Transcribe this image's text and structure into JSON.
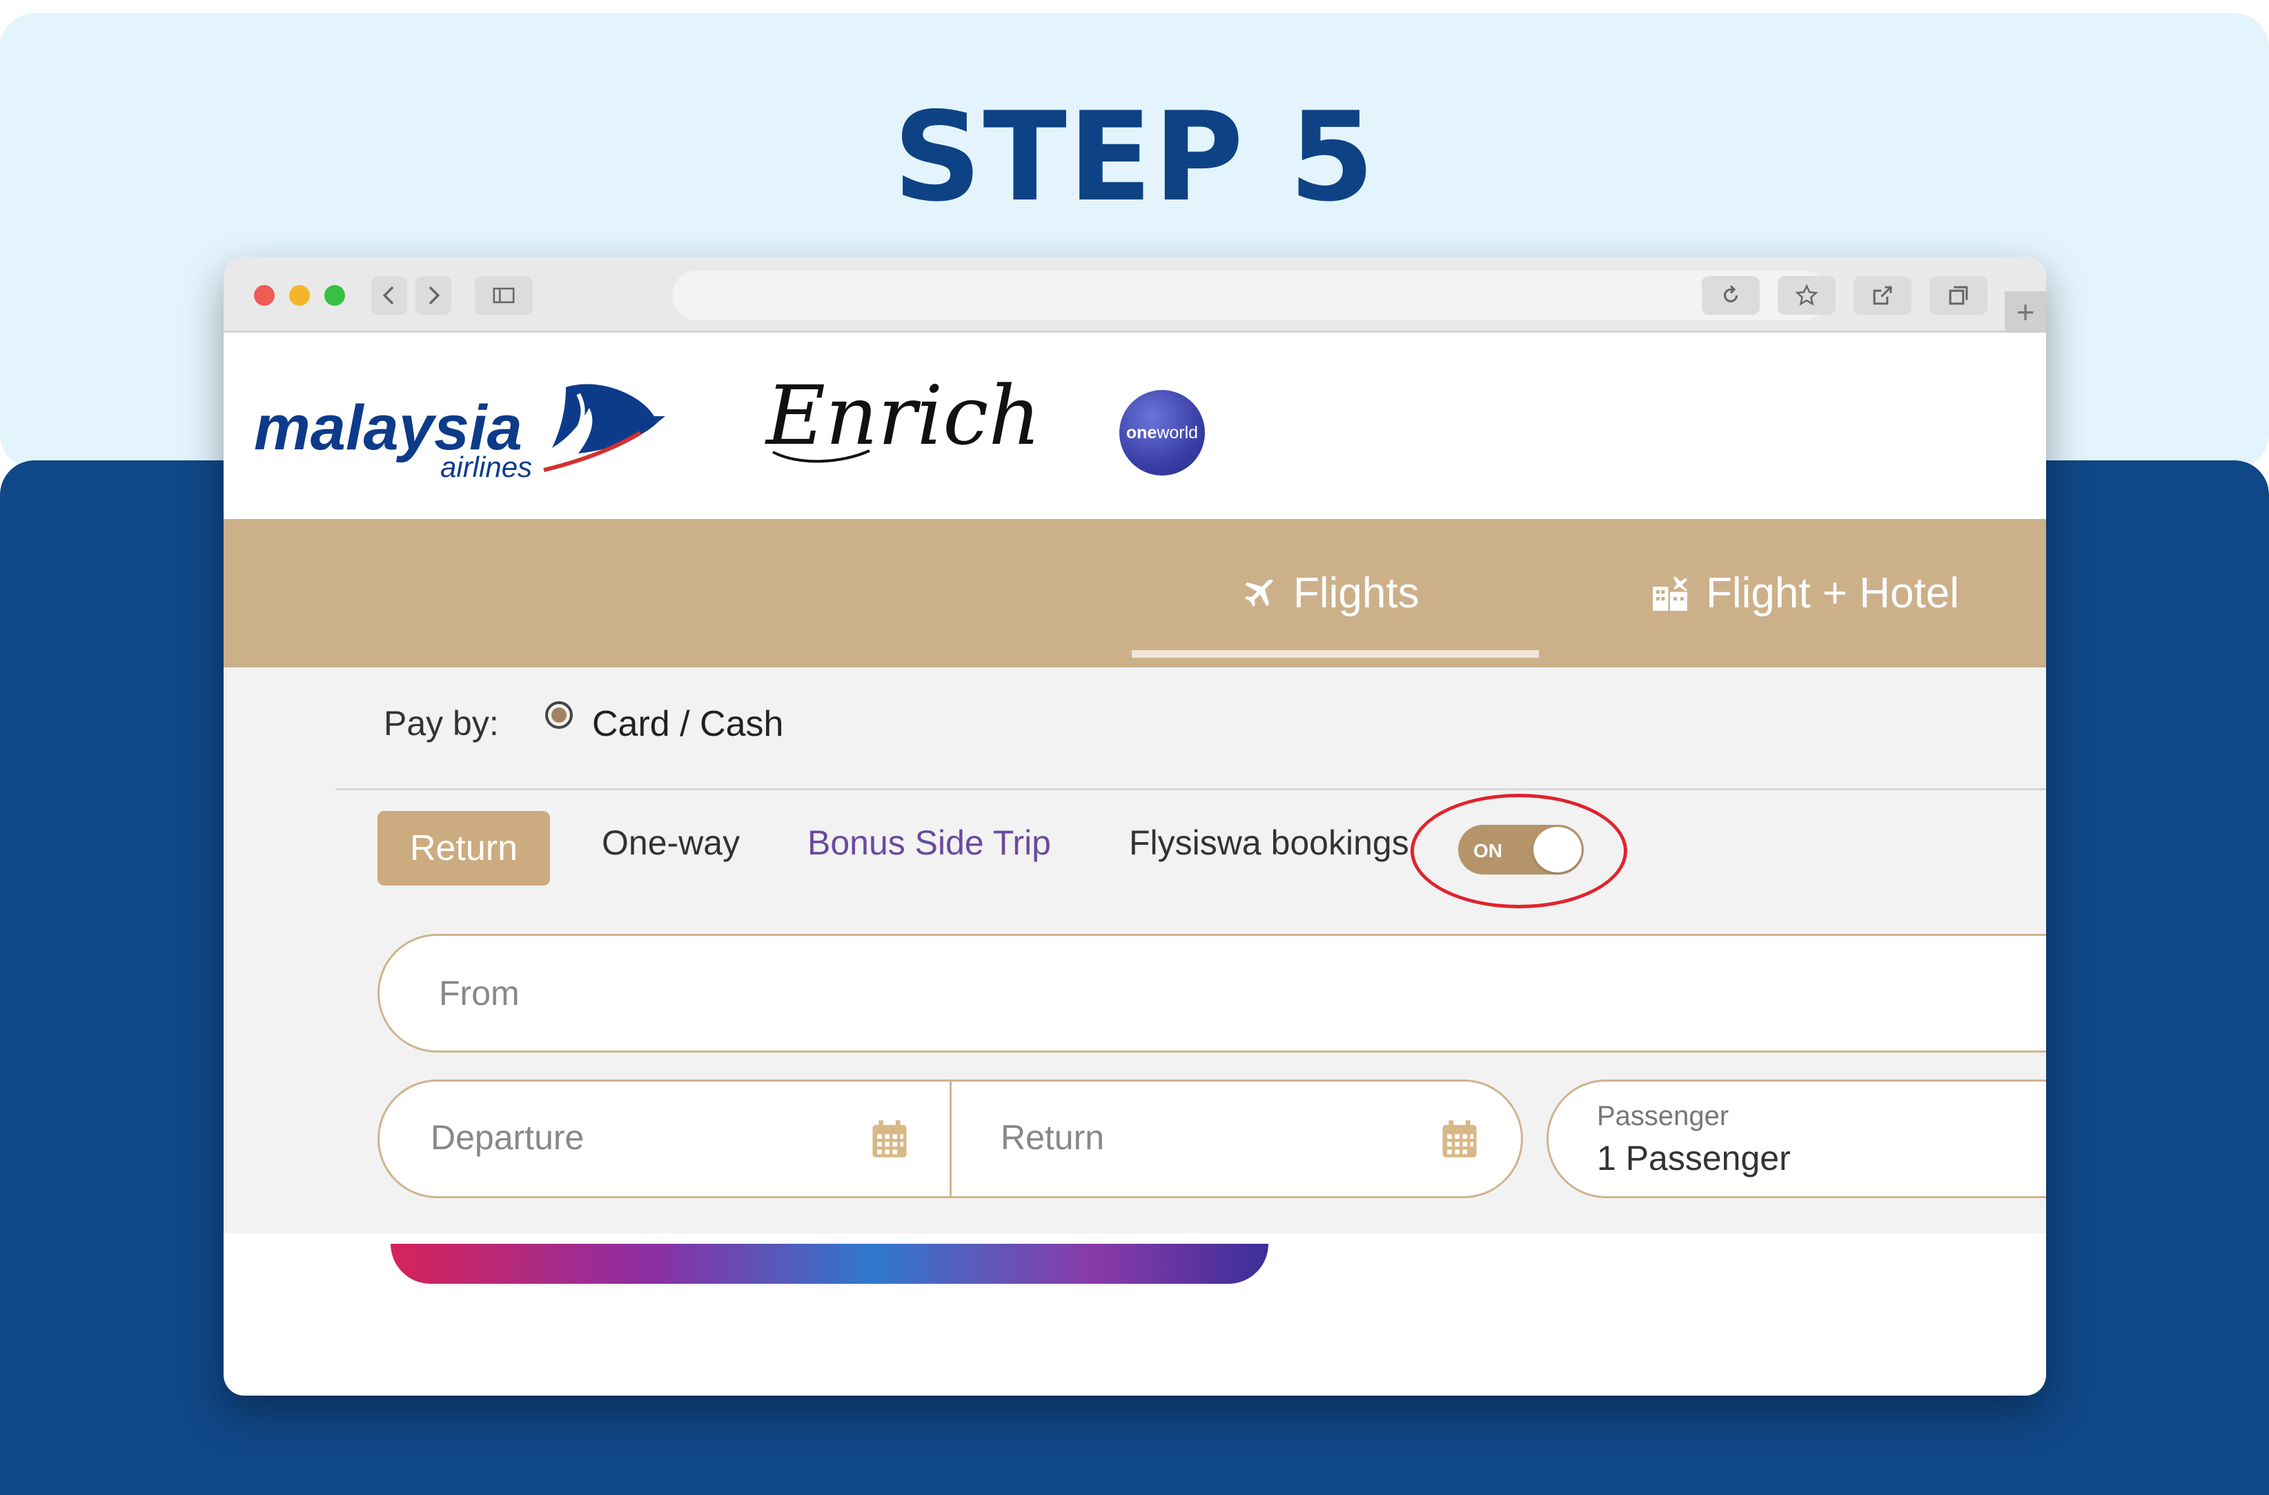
{
  "step_title": "STEP 5",
  "browser": {
    "newtab_label": "+"
  },
  "brand": {
    "malaysia_logo_text": "malaysia",
    "malaysia_logo_sub": "airlines",
    "enrich_logo_text": "Enrich",
    "oneworld_text_bold": "one",
    "oneworld_text_light": "world"
  },
  "nav": {
    "tabs": [
      {
        "label": "Flights",
        "active": true
      },
      {
        "label": "Flight + Hotel",
        "active": false
      }
    ]
  },
  "form": {
    "pay_by_label": "Pay by:",
    "pay_by_option": "Card / Cash",
    "trip_types": [
      "Return",
      "One-way",
      "Bonus Side Trip"
    ],
    "flysiswa_label": "Flysiswa bookings",
    "flysiswa_toggle": "ON",
    "from_placeholder": "From",
    "departure_placeholder": "Departure",
    "return_placeholder": "Return",
    "passenger_label": "Passenger",
    "passenger_value": "1 Passenger"
  },
  "colors": {
    "accent_gold": "#ccb08a",
    "highlight_red": "#e1232c",
    "title_blue": "#0d4385",
    "bonus_purple": "#6a4aa0"
  }
}
